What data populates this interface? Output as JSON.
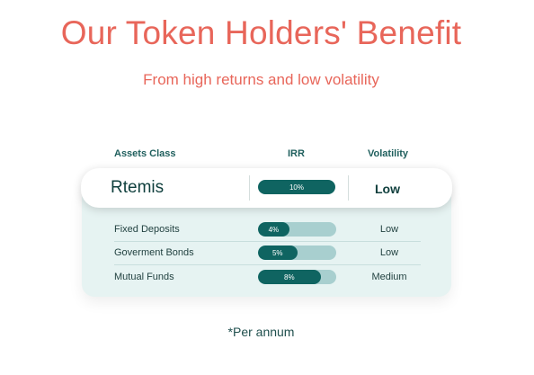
{
  "title": "Our Token Holders' Benefit",
  "subtitle": "From high returns and low volatility",
  "table": {
    "headers": {
      "asset_class": "Assets Class",
      "irr": "IRR",
      "volatility": "Volatility"
    },
    "featured": {
      "name": "Rtemis",
      "irr_label": "10%",
      "irr_fraction": 1.0,
      "volatility": "Low"
    },
    "rows": [
      {
        "name": "Fixed Deposits",
        "irr_label": "4%",
        "irr_fraction": 0.4,
        "volatility": "Low"
      },
      {
        "name": "Goverment Bonds",
        "irr_label": "5%",
        "irr_fraction": 0.5,
        "volatility": "Low"
      },
      {
        "name": "Mutual Funds",
        "irr_label": "8%",
        "irr_fraction": 0.8,
        "volatility": "Medium"
      }
    ]
  },
  "footnote": "*Per annum",
  "colors": {
    "accent": "#e8665a",
    "bar_fill": "#0f6461",
    "bar_track": "#a8cfcf",
    "panel_bg": "#e6f3f2"
  }
}
